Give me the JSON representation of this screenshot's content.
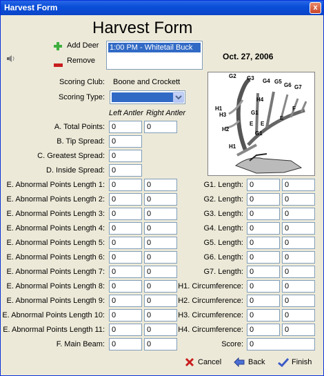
{
  "window": {
    "title": "Harvest Form",
    "close_glyph": "x"
  },
  "form": {
    "heading": "Harvest Form",
    "add_deer_label": "Add Deer",
    "remove_label": "Remove",
    "deer_list": [
      "1:00 PM - Whitetail Buck"
    ],
    "date": "Oct. 27, 2006",
    "scoring_club_label": "Scoring Club:",
    "scoring_club_value": "Boone and Crockett",
    "scoring_type_label": "Scoring Type:",
    "scoring_type_value": "",
    "left_antler_header": "Left Antler",
    "right_antler_header": "Right Antler"
  },
  "top_fields": [
    {
      "label": "A. Total Points:",
      "left": "0",
      "right": "0"
    },
    {
      "label": "B. Tip Spread:",
      "left": "0"
    },
    {
      "label": "C. Greatest Spread:",
      "left": "0"
    },
    {
      "label": "D. Inside Spread:",
      "left": "0"
    }
  ],
  "left_rows": [
    {
      "label": "E. Abnormal Points Length 1:",
      "left": "0",
      "right": "0"
    },
    {
      "label": "E. Abnormal Points Length 2:",
      "left": "0",
      "right": "0"
    },
    {
      "label": "E. Abnormal Points Length 3:",
      "left": "0",
      "right": "0"
    },
    {
      "label": "E. Abnormal Points Length 4:",
      "left": "0",
      "right": "0"
    },
    {
      "label": "E. Abnormal Points Length 5:",
      "left": "0",
      "right": "0"
    },
    {
      "label": "E. Abnormal Points Length 6:",
      "left": "0",
      "right": "0"
    },
    {
      "label": "E. Abnormal Points Length 7:",
      "left": "0",
      "right": "0"
    },
    {
      "label": "E. Abnormal Points Length 8:",
      "left": "0",
      "right": "0"
    },
    {
      "label": "E. Abnormal Points Length 9:",
      "left": "0",
      "right": "0"
    },
    {
      "label": "E. Abnormal Points Length 10:",
      "left": "0",
      "right": "0"
    },
    {
      "label": "E. Abnormal Points Length 11:",
      "left": "0",
      "right": "0"
    },
    {
      "label": "F. Main Beam:",
      "left": "0",
      "right": "0"
    }
  ],
  "right_rows": [
    {
      "label": "G1. Length:",
      "left": "0",
      "right": "0"
    },
    {
      "label": "G2. Length:",
      "left": "0",
      "right": "0"
    },
    {
      "label": "G3. Length:",
      "left": "0",
      "right": "0"
    },
    {
      "label": "G4. Length:",
      "left": "0",
      "right": "0"
    },
    {
      "label": "G5. Length:",
      "left": "0",
      "right": "0"
    },
    {
      "label": "G6. Length:",
      "left": "0",
      "right": "0"
    },
    {
      "label": "G7. Length:",
      "left": "0",
      "right": "0"
    },
    {
      "label": "H1. Circumference:",
      "left": "0",
      "right": "0"
    },
    {
      "label": "H2. Circumference:",
      "left": "0",
      "right": "0"
    },
    {
      "label": "H3. Circumference:",
      "left": "0",
      "right": "0"
    },
    {
      "label": "H4. Circumference:",
      "left": "0",
      "right": "0"
    }
  ],
  "score": {
    "label": "Score:",
    "value": "0"
  },
  "diagram_labels": [
    "G2",
    "G3",
    "G4",
    "G5",
    "G6",
    "G7",
    "H4",
    "H1",
    "H3",
    "G1",
    "E",
    "H2",
    "E",
    "F",
    "E",
    "H1",
    "G1"
  ],
  "buttons": {
    "cancel": "Cancel",
    "back": "Back",
    "finish": "Finish"
  },
  "colors": {
    "titlebar": "#0a4fd8",
    "selection": "#316ac5",
    "face": "#ece9d8"
  }
}
